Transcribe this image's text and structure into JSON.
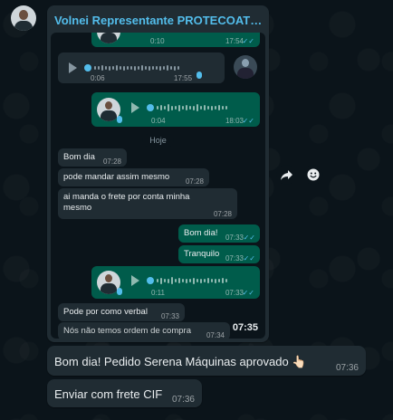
{
  "sender": {
    "name": "Volnei Representante PROTECOATING..."
  },
  "forwarded": {
    "voice_1": {
      "duration": "0:10",
      "time": "17:54"
    },
    "voice_2": {
      "duration": "0:06",
      "time": "17:55"
    },
    "voice_3": {
      "duration": "0:04",
      "time": "18:03"
    },
    "day_divider": "Hoje",
    "messages": [
      {
        "text": "Bom dia",
        "time": "07:28",
        "direction": "in"
      },
      {
        "text": "pode mandar assim mesmo",
        "time": "07:28",
        "direction": "in"
      },
      {
        "text": "ai manda o frete por conta minha mesmo",
        "time": "07:28",
        "direction": "in"
      },
      {
        "text": "Bom dia!",
        "time": "07:33",
        "direction": "out"
      },
      {
        "text": "Tranquilo",
        "time": "07:33",
        "direction": "out"
      },
      {
        "text": "Pode por como verbal",
        "time": "07:33",
        "direction": "in"
      },
      {
        "text": "Nós não temos ordem de compra",
        "time": "07:34",
        "direction": "in"
      }
    ],
    "voice_4": {
      "duration": "0:11",
      "time": "07:33"
    },
    "card_time": "07:35"
  },
  "main_messages": [
    {
      "text": "Bom dia! Pedido Serena Máquinas aprovado 👆🏻",
      "time": "07:36"
    },
    {
      "text": "Enviar com frete CIF",
      "time": "07:36"
    }
  ],
  "actions": {
    "forward_icon": "forward-icon",
    "react_icon": "emoji-icon"
  },
  "colors": {
    "background": "#0b141a",
    "incoming": "#202c33",
    "outgoing": "#005c4b",
    "accent": "#53bdeb"
  }
}
